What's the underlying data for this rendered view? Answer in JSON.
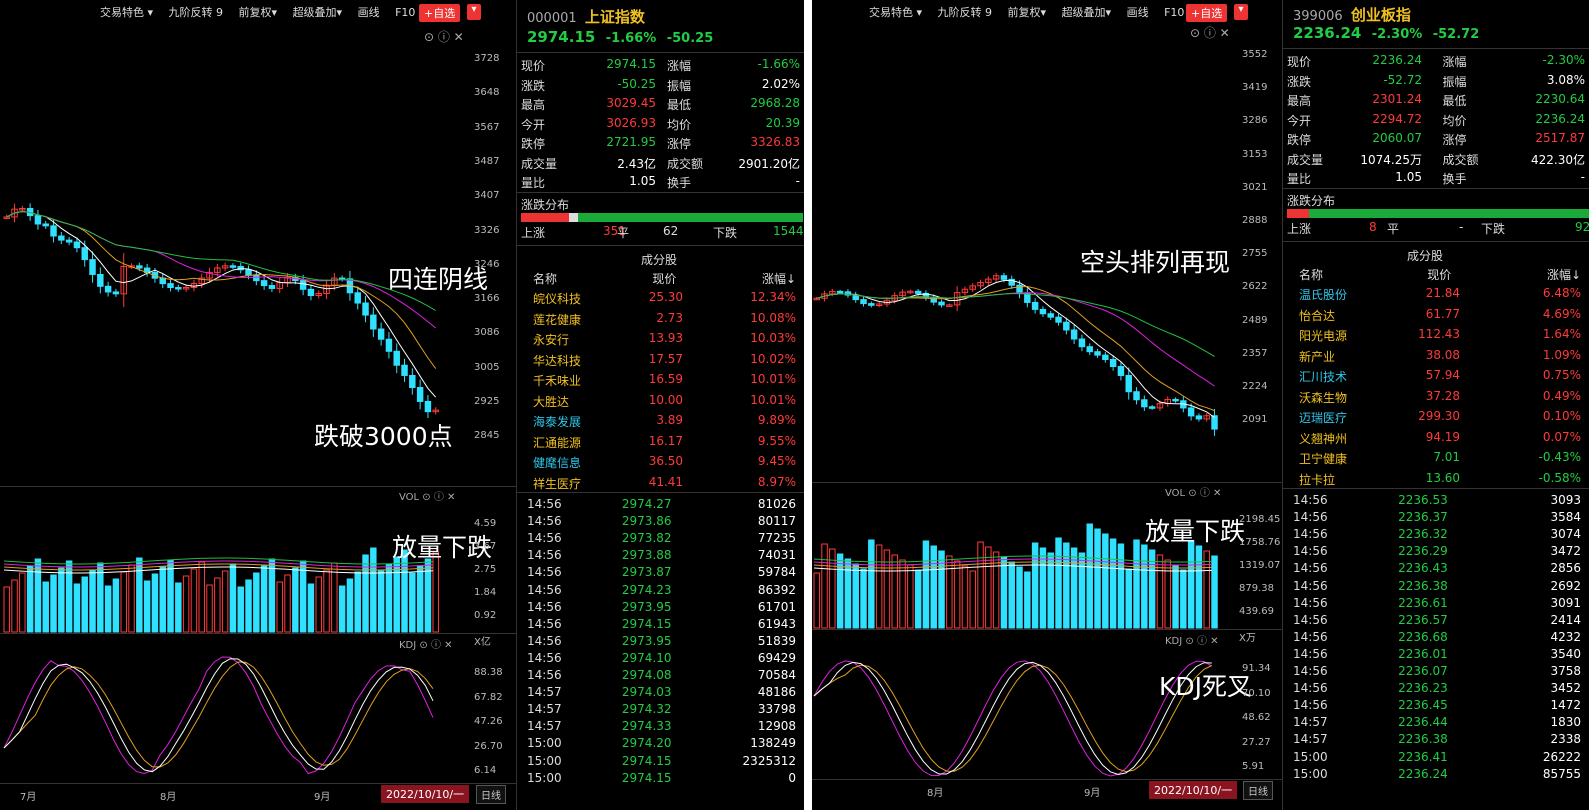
{
  "toolbar": {
    "items": [
      "交易特色 ▾",
      "九阶反转 9",
      "前复权▾",
      "超级叠加▾",
      "画线",
      "F10"
    ],
    "add": "+自选",
    "dd": "▾"
  },
  "left": {
    "code": "000001",
    "name": "上证指数",
    "price": "2974.15",
    "pct": "-1.66%",
    "chg": "-50.25",
    "yaxis": [
      "3728",
      "3648",
      "3567",
      "3487",
      "3407",
      "3326",
      "3246",
      "3166",
      "3086",
      "3005",
      "2925",
      "2845"
    ],
    "vol_axis": [
      "4.59",
      "3.67",
      "2.75",
      "1.84",
      "0.92",
      "X亿"
    ],
    "kdj_axis": [
      "88.38",
      "67.82",
      "47.26",
      "26.70",
      "6.14"
    ],
    "months": [
      "7月",
      "8月",
      "9月"
    ],
    "date": "2022/10/10/一",
    "dayline": "日线",
    "ann1": "四连阴线",
    "ann2": "跌破3000点",
    "ann3": "放量下跌",
    "vol_label": "VOL",
    "kdj_label": "KDJ",
    "stats": [
      [
        "现价",
        "2974.15",
        "涨幅",
        "-1.66%"
      ],
      [
        "涨跌",
        "-50.25",
        "振幅",
        "2.02%"
      ],
      [
        "最高",
        "3029.45",
        "最低",
        "2968.28"
      ],
      [
        "今开",
        "3026.93",
        "均价",
        "20.39"
      ],
      [
        "跌停",
        "2721.95",
        "涨停",
        "3326.83"
      ],
      [
        "成交量",
        "2.43亿",
        "成交额",
        "2901.20亿"
      ],
      [
        "量比",
        "1.05",
        "换手",
        "-"
      ]
    ],
    "dist_label": "涨跌分布",
    "dist": {
      "up_label": "上涨",
      "up": "351",
      "flat_label": "平",
      "flat": "62",
      "down_label": "下跌",
      "down": "1544"
    },
    "comp_title": "成分股",
    "comp_head": [
      "名称",
      "现价",
      "涨幅↓"
    ],
    "comp": [
      [
        "皖仪科技",
        "25.30",
        "12.34%"
      ],
      [
        "莲花健康",
        "2.73",
        "10.08%"
      ],
      [
        "永安行",
        "13.93",
        "10.03%"
      ],
      [
        "华达科技",
        "17.57",
        "10.02%"
      ],
      [
        "千禾味业",
        "16.59",
        "10.01%"
      ],
      [
        "大胜达",
        "10.00",
        "10.01%"
      ],
      [
        "海泰发展",
        "3.89",
        "9.89%"
      ],
      [
        "汇通能源",
        "16.17",
        "9.55%"
      ],
      [
        "健麾信息",
        "36.50",
        "9.45%"
      ],
      [
        "祥生医疗",
        "41.41",
        "8.97%"
      ]
    ],
    "ticks": [
      [
        "14:56",
        "2974.27",
        "81026"
      ],
      [
        "14:56",
        "2973.86",
        "80117"
      ],
      [
        "14:56",
        "2973.82",
        "77235"
      ],
      [
        "14:56",
        "2973.88",
        "74031"
      ],
      [
        "14:56",
        "2973.87",
        "59784"
      ],
      [
        "14:56",
        "2974.23",
        "86392"
      ],
      [
        "14:56",
        "2973.95",
        "61701"
      ],
      [
        "14:56",
        "2974.15",
        "61943"
      ],
      [
        "14:56",
        "2973.95",
        "51839"
      ],
      [
        "14:56",
        "2974.10",
        "69429"
      ],
      [
        "14:56",
        "2974.08",
        "70584"
      ],
      [
        "14:57",
        "2974.03",
        "48186"
      ],
      [
        "14:57",
        "2974.32",
        "33798"
      ],
      [
        "14:57",
        "2974.33",
        "12908"
      ],
      [
        "15:00",
        "2974.20",
        "138249"
      ],
      [
        "15:00",
        "2974.15",
        "2325312"
      ],
      [
        "15:00",
        "2974.15",
        "0"
      ]
    ]
  },
  "right": {
    "code": "399006",
    "name": "创业板指",
    "price": "2236.24",
    "pct": "-2.30%",
    "chg": "-52.72",
    "yaxis": [
      "3552",
      "3419",
      "3286",
      "3153",
      "3021",
      "2888",
      "2755",
      "2622",
      "2489",
      "2357",
      "2224",
      "2091"
    ],
    "vol_axis": [
      "2198.45",
      "1758.76",
      "1319.07",
      "879.38",
      "439.69",
      "X万"
    ],
    "kdj_axis": [
      "91.34",
      "70.10",
      "48.62",
      "27.27",
      "5.91"
    ],
    "months": [
      "8月",
      "9月"
    ],
    "date": "2022/10/10/一",
    "dayline": "日线",
    "ann1": "空头排列再现",
    "ann2": "放量下跌",
    "ann3": "KDJ死叉",
    "vol_label": "VOL",
    "kdj_label": "KDJ",
    "stats": [
      [
        "现价",
        "2236.24",
        "涨幅",
        "-2.30%"
      ],
      [
        "涨跌",
        "-52.72",
        "振幅",
        "3.08%"
      ],
      [
        "最高",
        "2301.24",
        "最低",
        "2230.64"
      ],
      [
        "今开",
        "2294.72",
        "均价",
        "2236.24"
      ],
      [
        "跌停",
        "2060.07",
        "涨停",
        "2517.87"
      ],
      [
        "成交量",
        "1074.25万",
        "成交额",
        "422.30亿"
      ],
      [
        "量比",
        "1.05",
        "换手",
        "-"
      ]
    ],
    "dist_label": "涨跌分布",
    "dist": {
      "up_label": "上涨",
      "up": "8",
      "flat_label": "平",
      "flat": "-",
      "down_label": "下跌",
      "down": "92"
    },
    "comp_title": "成分股",
    "comp_head": [
      "名称",
      "现价",
      "涨幅↓"
    ],
    "comp": [
      [
        "温氏股份",
        "21.84",
        "6.48%"
      ],
      [
        "怡合达",
        "61.77",
        "4.69%"
      ],
      [
        "阳光电源",
        "112.43",
        "1.64%"
      ],
      [
        "新产业",
        "38.08",
        "1.09%"
      ],
      [
        "汇川技术",
        "57.94",
        "0.75%"
      ],
      [
        "沃森生物",
        "37.28",
        "0.49%"
      ],
      [
        "迈瑞医疗",
        "299.30",
        "0.10%"
      ],
      [
        "义翘神州",
        "94.19",
        "0.07%"
      ],
      [
        "卫宁健康",
        "7.01",
        "-0.43%"
      ],
      [
        "拉卡拉",
        "13.60",
        "-0.58%"
      ]
    ],
    "ticks": [
      [
        "14:56",
        "2236.53",
        "3093"
      ],
      [
        "14:56",
        "2236.37",
        "3584"
      ],
      [
        "14:56",
        "2236.32",
        "3074"
      ],
      [
        "14:56",
        "2236.29",
        "3472"
      ],
      [
        "14:56",
        "2236.43",
        "2856"
      ],
      [
        "14:56",
        "2236.38",
        "2692"
      ],
      [
        "14:56",
        "2236.61",
        "3091"
      ],
      [
        "14:56",
        "2236.57",
        "2414"
      ],
      [
        "14:56",
        "2236.68",
        "4232"
      ],
      [
        "14:56",
        "2236.01",
        "3540"
      ],
      [
        "14:56",
        "2236.07",
        "3758"
      ],
      [
        "14:56",
        "2236.23",
        "3452"
      ],
      [
        "14:56",
        "2236.45",
        "1472"
      ],
      [
        "14:57",
        "2236.44",
        "1830"
      ],
      [
        "14:57",
        "2236.38",
        "2338"
      ],
      [
        "15:00",
        "2236.41",
        "26222"
      ],
      [
        "15:00",
        "2236.24",
        "85755"
      ]
    ]
  }
}
